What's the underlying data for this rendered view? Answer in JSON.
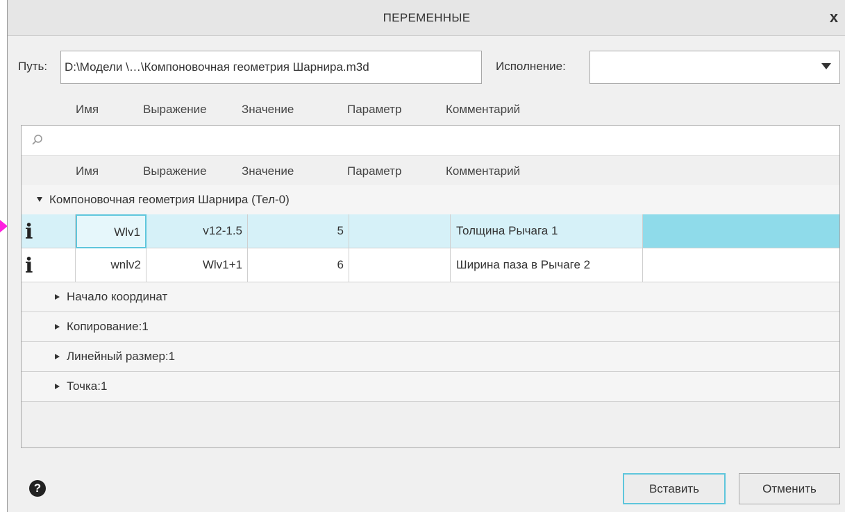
{
  "dialog": {
    "title": "ПЕРЕМЕННЫЕ",
    "close_glyph": "x"
  },
  "path": {
    "label": "Путь:",
    "value": "D:\\Модели \\…\\Компоновочная геометрия Шарнира.m3d"
  },
  "execution": {
    "label": "Исполнение:",
    "value": ""
  },
  "columns": [
    "Имя",
    "Выражение",
    "Значение",
    "Параметр",
    "Комментарий"
  ],
  "search": {
    "placeholder": "",
    "icon": "search-icon"
  },
  "group": {
    "label": "Компоновочная геометрия Шарнира (Тел-0)",
    "expanded": true,
    "rows": [
      {
        "icon": "i",
        "name": "Wlv1",
        "expression": "v12-1.5",
        "value": "5",
        "parameter": "",
        "comment": "Толщина Рычага 1",
        "selected": true
      },
      {
        "icon": "i",
        "name": "wnlv2",
        "expression": "Wlv1+1",
        "value": "6",
        "parameter": "",
        "comment": "Ширина паза в Рычаге 2",
        "selected": false
      }
    ]
  },
  "subgroups": [
    "Начало координат",
    "Копирование:1",
    "Линейный размер:1",
    "Точка:1"
  ],
  "footer": {
    "help_glyph": "?",
    "insert_label": "Вставить",
    "cancel_label": "Отменить"
  },
  "colors": {
    "selected_row": "#d6f1f8",
    "selected_tail": "#8fdbea",
    "focus_border": "#5ec6dc",
    "marker": "#ff1ee0"
  }
}
